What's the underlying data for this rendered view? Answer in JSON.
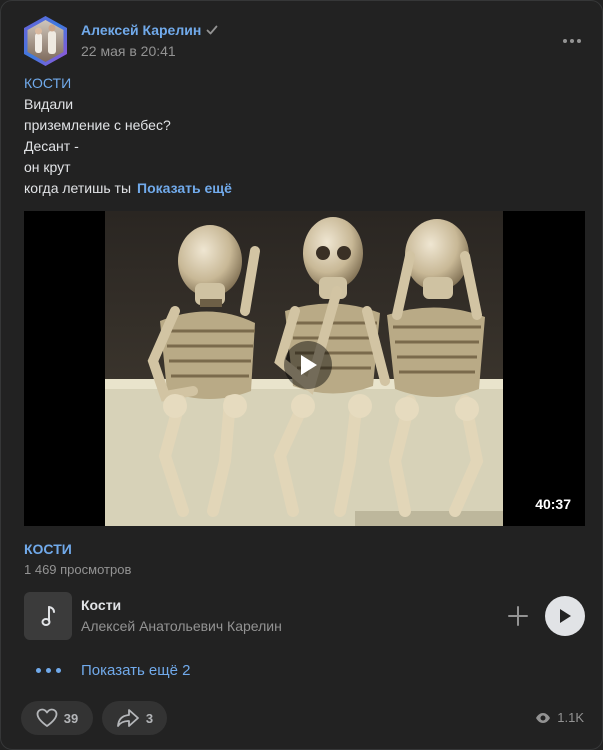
{
  "post": {
    "author": "Алексей Карелин",
    "date": "22 мая в 20:41",
    "tag": "КОСТИ",
    "text_lines": [
      "Видали",
      "приземление с небес?",
      "Десант -",
      "он крут",
      "когда летишь ты"
    ],
    "show_more": "Показать ещё"
  },
  "video": {
    "duration": "40:37",
    "title": "КОСТИ",
    "views": "1 469 просмотров"
  },
  "audio": {
    "title": "Кости",
    "artist": "Алексей Анатольевич Карелин"
  },
  "attachments": {
    "show_more": "Показать ещё 2"
  },
  "footer": {
    "likes": "39",
    "shares": "3",
    "views": "1.1K"
  },
  "icons": {
    "verified": "check-icon",
    "more": "more-horizontal-icon",
    "play": "play-icon",
    "music": "music-note-icon",
    "add": "plus-icon",
    "like": "heart-icon",
    "share": "share-arrow-icon",
    "views": "eye-icon"
  },
  "colors": {
    "background": "#222222",
    "accent": "#71aaeb",
    "text": "#e1e3e6",
    "secondary": "#939393"
  }
}
